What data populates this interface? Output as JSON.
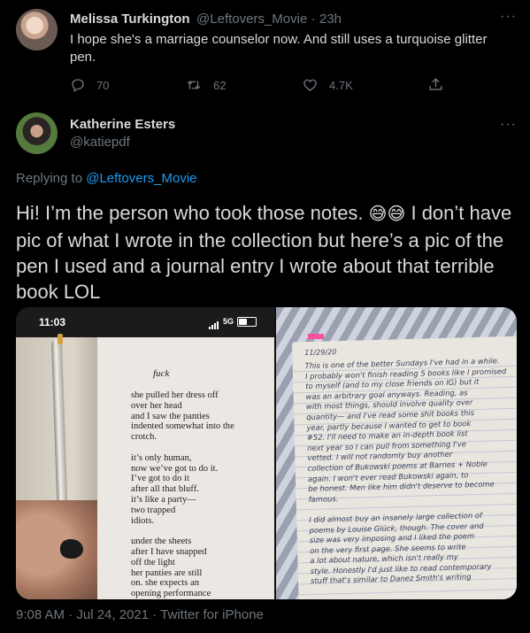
{
  "reply_tweet": {
    "author_name": "Melissa Turkington",
    "author_handle": "@Leftovers_Movie",
    "time_ago": "· 23h",
    "text": "I hope she's a marriage counselor now. And still uses a turquoise glitter pen.",
    "reply_count": "70",
    "retweet_count": "62",
    "like_count": "4.7K",
    "more_label": "···"
  },
  "main_tweet": {
    "author_name": "Katherine Esters",
    "author_handle": "@katiepdf",
    "more_label": "···",
    "replying_prefix": "Replying to",
    "replying_handle": "@Leftovers_Movie",
    "text_part1": "Hi! I’m the person who took those notes. ",
    "emoji": "😅😅",
    "text_part2": " I don’t have pic of what I wrote in the collection but here’s a pic of the pen I used and a journal entry I wrote about that terrible book LOL",
    "timestamp": "9:08 AM · Jul 24, 2021 · Twitter for iPhone"
  },
  "photo_left": {
    "status_time": "11:03",
    "status_network": "5G",
    "book_heading": "fuck",
    "poem": "she pulled her dress off\nover her head\nand I saw the panties\nindented somewhat into the\ncrotch.\n\nit’s only human,\nnow we’ve got to do it.\nI’ve got to do it\nafter all that bluff.\nit’s like a party—\ntwo trapped\nidiots.\n\nunder the sheets\nafter I have snapped\noff the light\nher panties are still\non. she expects an\nopening performance"
  },
  "photo_right": {
    "date": "11/29/20",
    "entry": "This is one of the better Sundays I've had in a while.\nI probably won't finish reading 5 books like I promised\nto myself (and to my close friends on IG) but it\nwas an arbitrary goal anyways. Reading, as\nwith most things, should involve quality over\nquantity— and I've read some shit books this\nyear, partly because I wanted to get to book\n#52. I'll need to make an in-depth book list\nnext year so I can pull from something I've\nvetted. I will not randomly buy another\ncollection of Bukowski poems at Barnes + Noble\nagain. I won't ever read Bukowski again, to\nbe honest. Men like him didn't deserve to become\nfamous.\n\nI did almost buy an insanely large collection of\npoems by Louise Glück, though. The cover and\nsize was very imposing and I liked the poem\non the very first page. She seems to write\na lot about nature, which isn't really my\nstyle. Honestly I'd just like to read contemporary\nstuff that's similar to Danez Smith's writing"
  },
  "colors": {
    "background": "#000000",
    "text": "#d9d9d9",
    "muted": "#6e767d",
    "accent": "#1d9bf0"
  }
}
